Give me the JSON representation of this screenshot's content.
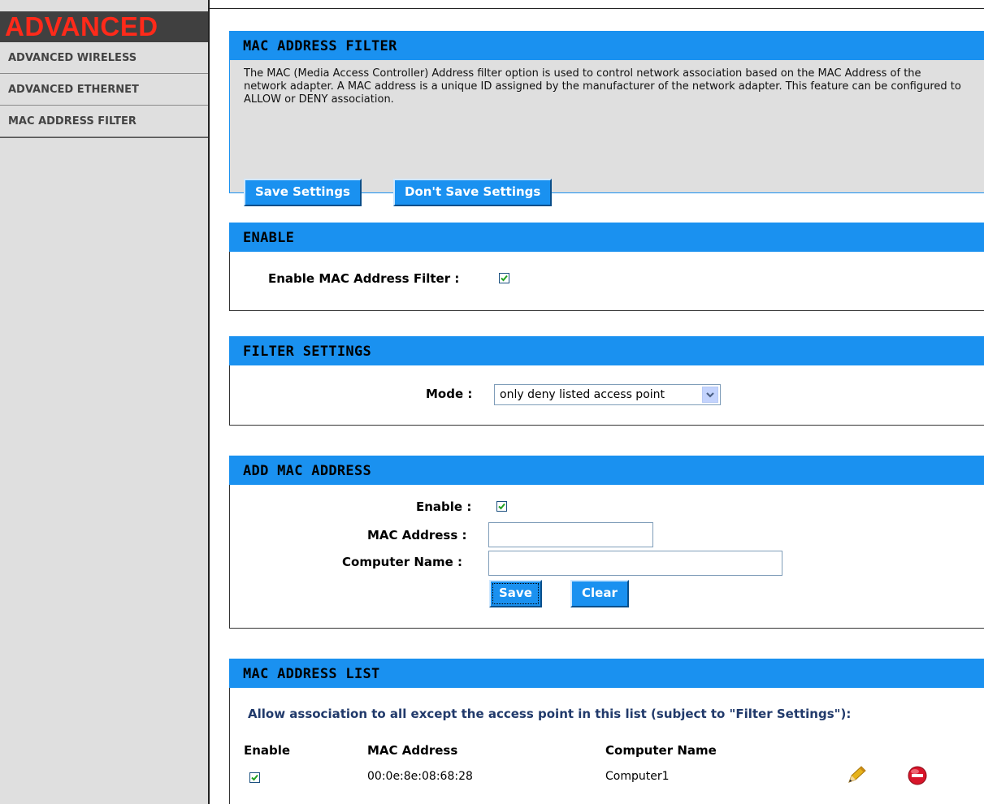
{
  "sidebar": {
    "title": "ADVANCED",
    "items": [
      {
        "label": "ADVANCED WIRELESS"
      },
      {
        "label": "ADVANCED ETHERNET"
      },
      {
        "label": "MAC ADDRESS FILTER"
      }
    ]
  },
  "mac_filter": {
    "title": "MAC ADDRESS FILTER",
    "description": "The MAC (Media Access Controller) Address filter option is used to control network association based on the MAC Address of the network adapter. A MAC address is a unique ID assigned by the manufacturer of the network adapter. This feature can be configured to ALLOW or DENY association.",
    "save_label": "Save Settings",
    "dont_save_label": "Don't Save Settings"
  },
  "enable": {
    "title": "ENABLE",
    "label": "Enable MAC Address Filter :",
    "checked": true
  },
  "filter_settings": {
    "title": "FILTER SETTINGS",
    "mode_label": "Mode :",
    "mode_value": "only deny listed access point"
  },
  "add_mac": {
    "title": "ADD MAC ADDRESS",
    "enable_label": "Enable :",
    "enable_checked": true,
    "mac_label": "MAC Address :",
    "mac_value": "",
    "computer_label": "Computer Name :",
    "computer_value": "",
    "save_label": "Save",
    "clear_label": "Clear"
  },
  "mac_list": {
    "title": "MAC ADDRESS LIST",
    "heading": "Allow association to all except the access point in this list (subject to \"Filter Settings\"):",
    "columns": [
      "Enable",
      "MAC Address",
      "Computer Name"
    ],
    "rows": [
      {
        "enabled": true,
        "mac": "00:0e:8e:08:68:28",
        "computer": "Computer1",
        "edit_icon": "pencil-icon",
        "delete_icon": "delete-icon"
      }
    ]
  },
  "colors": {
    "accent": "#1a91f0",
    "sidebar_bg": "#dfdfdf",
    "sidebar_header_bg": "#404040",
    "brand_red": "#ff2a1a"
  }
}
